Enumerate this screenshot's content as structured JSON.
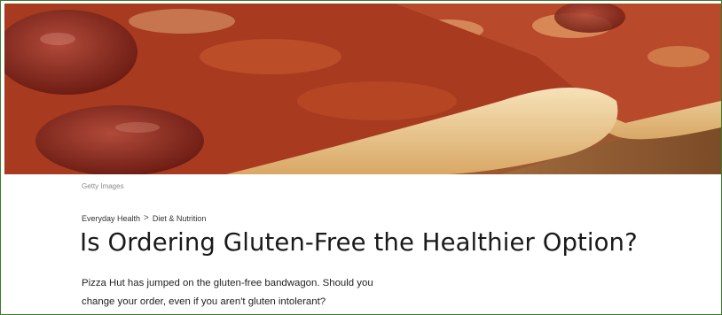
{
  "article": {
    "image_credit": "Getty Images",
    "breadcrumb": [
      "Everyday Health",
      "Diet & Nutrition"
    ],
    "breadcrumb_separator": ">",
    "title": "Is Ordering Gluten-Free the Healthier Option?",
    "dek_line1": "Pizza Hut has jumped on the gluten-free bandwagon. Should you",
    "dek_line2": "change your order, even if you aren't gluten intolerant?"
  },
  "colors": {
    "border": "#3b7a2e",
    "sauce": "#a8321c",
    "crust": "#f1d7a8",
    "pepperoni": "#7a2418"
  }
}
